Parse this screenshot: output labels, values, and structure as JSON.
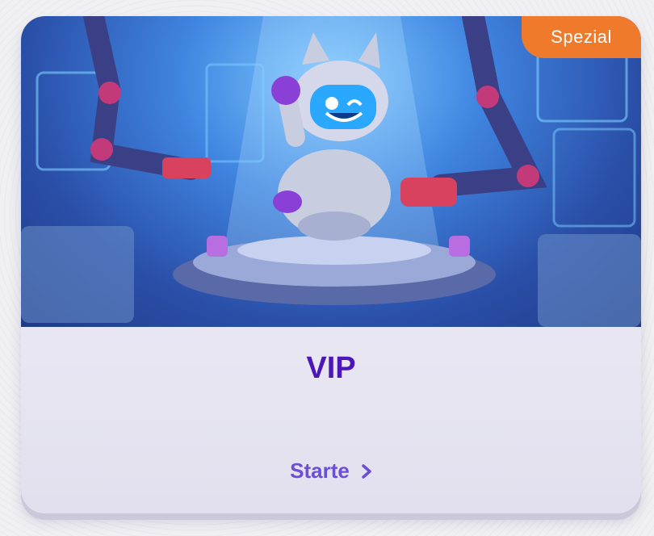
{
  "card": {
    "badge": "Spezial",
    "title": "VIP",
    "cta_label": "Starte"
  },
  "colors": {
    "badge": "#ef7a2b",
    "title": "#4b17b8",
    "cta": "#6b4fd6"
  },
  "icons": {
    "cta": "chevron-right-icon"
  }
}
